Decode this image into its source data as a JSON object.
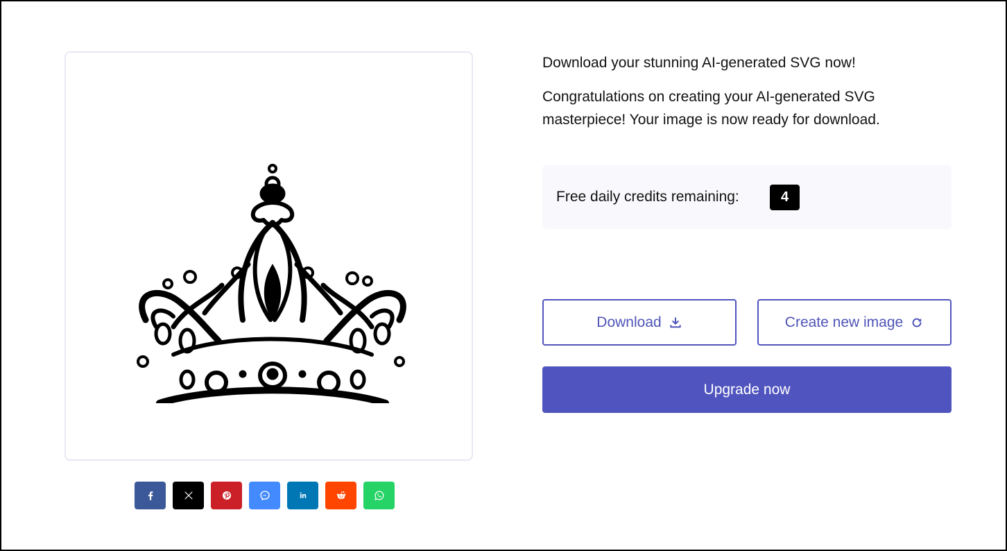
{
  "preview": {
    "image_alt": "crown illustration"
  },
  "share": [
    {
      "name": "facebook",
      "icon": "facebook-icon",
      "color": "#3b5998"
    },
    {
      "name": "x",
      "icon": "x-icon",
      "color": "#000000"
    },
    {
      "name": "pinterest",
      "icon": "pinterest-icon",
      "color": "#cb2027"
    },
    {
      "name": "messenger",
      "icon": "messenger-icon",
      "color": "#448aff"
    },
    {
      "name": "linkedin",
      "icon": "linkedin-icon",
      "color": "#0077b5"
    },
    {
      "name": "reddit",
      "icon": "reddit-icon",
      "color": "#ff4500"
    },
    {
      "name": "whatsapp",
      "icon": "whatsapp-icon",
      "color": "#25d366"
    }
  ],
  "content": {
    "headline": "Download your stunning AI-generated SVG now!",
    "congrats": "Congratulations on creating your AI-generated SVG masterpiece! Your image is now ready for download."
  },
  "credits": {
    "label": "Free daily credits remaining:",
    "count": "4"
  },
  "actions": {
    "download_label": "Download",
    "create_label": "Create new image",
    "upgrade_label": "Upgrade now"
  },
  "colors": {
    "accent": "#5054be",
    "credits_bg": "#f9f9fd"
  }
}
